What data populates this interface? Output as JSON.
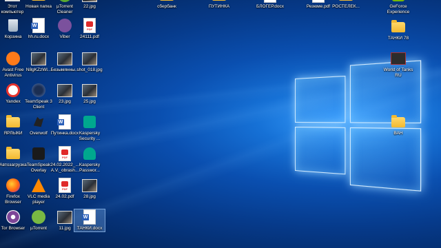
{
  "desktop": {
    "top_row": [
      {
        "label": "Этот компьютер",
        "icon": "this-pc-icon"
      },
      {
        "label": "Новая папка",
        "icon": "folder-icon"
      },
      {
        "label": "µTorrent Cleaner",
        "icon": "utorrent-cleaner-icon"
      },
      {
        "label": "22.jpg",
        "icon": "image-file-icon"
      },
      {
        "label": "сбербанк",
        "icon": "folder-icon"
      },
      {
        "label": "ПУТИНКА",
        "icon": "folder-icon"
      },
      {
        "label": "БЛОГЕР.docx",
        "icon": "word-document-icon"
      },
      {
        "label": "Резюме.pdf",
        "icon": "pdf-file-icon"
      },
      {
        "label": "РОСТЕЛЕК...",
        "icon": "folder-icon"
      },
      {
        "label": "GeForce Experience",
        "icon": "geforce-icon"
      }
    ],
    "columns": [
      [
        {
          "label": "Корзина",
          "icon": "recycle-bin-icon"
        },
        {
          "label": "Avast Free Antivirus",
          "icon": "avast-icon"
        },
        {
          "label": "Yandex",
          "icon": "yandex-browser-icon"
        },
        {
          "label": "ЯРЛЫКИ",
          "icon": "folder-icon"
        },
        {
          "label": "Автозагрузка",
          "icon": "folder-icon"
        },
        {
          "label": "Firefox Browser",
          "icon": "firefox-icon"
        },
        {
          "label": "Tor Browser",
          "icon": "tor-browser-icon"
        }
      ],
      [
        {
          "label": "hh.ru.docx",
          "icon": "word-document-icon"
        },
        {
          "label": "N8gKZzWl...",
          "icon": "image-file-icon"
        },
        {
          "label": "TeamSpeak 3 Client",
          "icon": "teamspeak-icon"
        },
        {
          "label": "Overwolf",
          "icon": "overwolf-icon"
        },
        {
          "label": "TeamSpeak Overlay",
          "icon": "teamspeak-overlay-icon"
        },
        {
          "label": "VLC media player",
          "icon": "vlc-icon"
        },
        {
          "label": "µTorrent",
          "icon": "utorrent-icon"
        }
      ],
      [
        {
          "label": "Viber",
          "icon": "viber-icon"
        },
        {
          "label": "Безымянны...",
          "icon": "image-file-icon"
        },
        {
          "label": "23.jpg",
          "icon": "image-file-icon"
        },
        {
          "label": "Путинка.docx",
          "icon": "word-document-icon"
        },
        {
          "label": "24.02.2022_... A.V._obrash...",
          "icon": "pdf-file-icon"
        },
        {
          "label": "24.02.pdf",
          "icon": "pdf-file-icon"
        },
        {
          "label": "11.jpg",
          "icon": "image-file-icon"
        }
      ],
      [
        {
          "label": "24111.pdf",
          "icon": "pdf-file-icon"
        },
        {
          "label": "shot_018.jpg",
          "icon": "image-file-icon"
        },
        {
          "label": "25.jpg",
          "icon": "image-file-icon"
        },
        {
          "label": "Kaspersky Security ...",
          "icon": "kaspersky-icon"
        },
        {
          "label": "Kaspersky Passwor...",
          "icon": "kaspersky-password-icon"
        },
        {
          "label": "28.jpg",
          "icon": "image-file-icon"
        },
        {
          "label": "ТАНКИ.docx",
          "icon": "word-document-icon",
          "selected": true
        }
      ]
    ],
    "right_column": [
      {
        "label": "ТАНКИ 78",
        "icon": "folder-icon"
      },
      {
        "label": "World of Tanks RU",
        "icon": "world-of-tanks-icon"
      },
      {
        "label": "ВАН",
        "icon": "folder-icon"
      }
    ]
  },
  "colors": {
    "wallpaper_accent": "#1671d6",
    "selection": "#78aae6"
  }
}
